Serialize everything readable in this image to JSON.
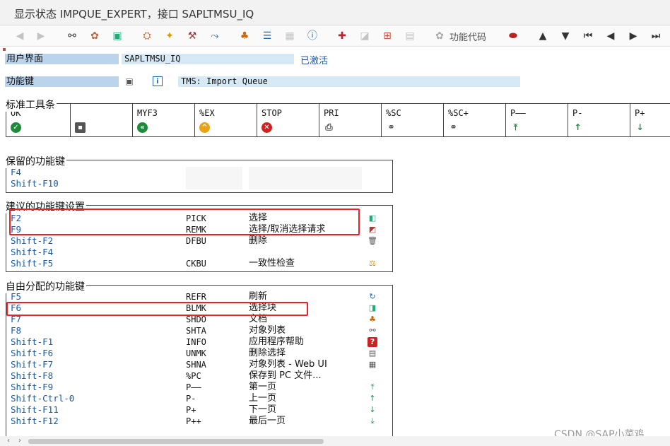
{
  "window": {
    "title": "显示状态 IMPQUE_EXPERT，接口 SAPLTMSU_IQ"
  },
  "toolbar": {
    "function_code_label": "功能代码"
  },
  "header": {
    "user_interface_label": "用户界面",
    "user_interface_value": "SAPLTMSU_IQ",
    "status_text": "已激活",
    "function_keys_label": "功能键",
    "function_keys_value": "TMS: Import Queue"
  },
  "standard_toolbar": {
    "title": "标准工具条",
    "items": [
      {
        "code": "OK",
        "icon": "check-icon",
        "color": "#1e8b3a"
      },
      {
        "code": "",
        "icon": "save-icon",
        "color": "#555555"
      },
      {
        "code": "MYF3",
        "icon": "back-icon",
        "color": "#1e8b3a"
      },
      {
        "code": "%EX",
        "icon": "exit-icon",
        "color": "#e8a317"
      },
      {
        "code": "STOP",
        "icon": "cancel-icon",
        "color": "#cc2222"
      },
      {
        "code": "PRI",
        "icon": "print-icon",
        "color": "#555555"
      },
      {
        "code": "%SC",
        "icon": "find-icon",
        "color": "#444444"
      },
      {
        "code": "%SC+",
        "icon": "find-next-icon",
        "color": "#444444"
      },
      {
        "code": "P——",
        "icon": "first-page-icon",
        "color": "#1e8b3a"
      },
      {
        "code": "P-",
        "icon": "previous-page-icon",
        "color": "#1e8b3a"
      },
      {
        "code": "P+",
        "icon": "next-page-icon",
        "color": "#1e8b3a"
      }
    ]
  },
  "reserved_keys": {
    "title": "保留的功能键",
    "rows": [
      {
        "key": "F4"
      },
      {
        "key": "Shift-F10"
      }
    ]
  },
  "recommended_keys": {
    "title": "建议的功能键设置",
    "rows": [
      {
        "key": "F2",
        "code": "PICK",
        "desc": "选择",
        "icon": "select-icon"
      },
      {
        "key": "F9",
        "code": "REMK",
        "desc": "选择/取消选择请求",
        "icon": "select-deselect-icon"
      },
      {
        "key": "Shift-F2",
        "code": "DFBU",
        "desc": "删除",
        "icon": "trash-icon"
      },
      {
        "key": "Shift-F4",
        "code": "",
        "desc": "",
        "icon": ""
      },
      {
        "key": "Shift-F5",
        "code": "CKBU",
        "desc": "一致性检查",
        "icon": "consistency-check-icon"
      }
    ]
  },
  "free_keys": {
    "title": "自由分配的功能键",
    "rows": [
      {
        "key": "F5",
        "code": "REFR",
        "desc": "刷新",
        "icon": "refresh-icon"
      },
      {
        "key": "F6",
        "code": "BLMK",
        "desc": "选择块",
        "icon": "select-block-icon"
      },
      {
        "key": "F7",
        "code": "SHDO",
        "desc": "文档",
        "icon": "documentation-icon"
      },
      {
        "key": "F8",
        "code": "SHTA",
        "desc": "对象列表",
        "icon": "object-list-icon"
      },
      {
        "key": "Shift-F1",
        "code": "INFO",
        "desc": "应用程序帮助",
        "icon": "help-icon"
      },
      {
        "key": "Shift-F6",
        "code": "UNMK",
        "desc": "删除选择",
        "icon": "deselect-icon"
      },
      {
        "key": "Shift-F7",
        "code": "SHNA",
        "desc": "对象列表 - Web UI",
        "icon": "web-list-icon"
      },
      {
        "key": "Shift-F8",
        "code": "%PC",
        "desc": "保存到 PC 文件...",
        "icon": ""
      },
      {
        "key": "Shift-F9",
        "code": "P——",
        "desc": "第一页",
        "icon": "first-page-icon"
      },
      {
        "key": "Shift-Ctrl-0",
        "code": "P-",
        "desc": "上一页",
        "icon": "previous-page-icon"
      },
      {
        "key": "Shift-F11",
        "code": "P+",
        "desc": "下一页",
        "icon": "next-page-icon"
      },
      {
        "key": "Shift-F12",
        "code": "P++",
        "desc": "最后一页",
        "icon": "last-page-icon"
      }
    ]
  },
  "watermark": "CSDN @SAP小菜鸡",
  "colors": {
    "highlight": "#e8232a",
    "key_text": "#1b5aa3",
    "label_bg": "#bcd3ec",
    "value_bg": "#d6e9f4"
  }
}
